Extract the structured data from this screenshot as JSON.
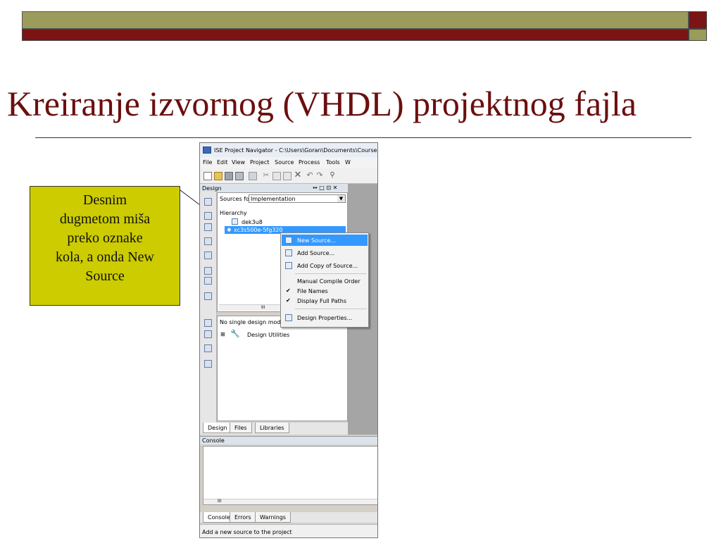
{
  "slide": {
    "title": "Kreiranje izvornog (VHDL) projektnog fajla",
    "callout_lines": [
      "Desnim",
      "dugmetom miša",
      "preko oznake",
      "kola, a onda New",
      "Source"
    ],
    "colors": {
      "olive": "#9b9b5c",
      "dark_red": "#7b1414",
      "callout_yellow": "#cccc00",
      "title": "#6b0f0f"
    }
  },
  "window": {
    "title": "ISE Project Navigator - C:\\Users\\Goran\\Documents\\Courses",
    "menu": [
      "File",
      "Edit",
      "View",
      "Project",
      "Source",
      "Process",
      "Tools",
      "W"
    ],
    "toolbar_icons": [
      "new-file-icon",
      "open-folder-icon",
      "save-icon",
      "save-all-icon",
      "print-icon",
      "cut-icon",
      "copy-icon",
      "paste-icon",
      "delete-icon",
      "undo-icon",
      "redo-icon",
      "find-icon"
    ],
    "design_panel": {
      "header": "Design",
      "header_controls": "↔ □ ⊡ ✕",
      "sources_for_label": "Sources for:",
      "sources_for_value": "Implementation",
      "hierarchy_label": "Hierarchy",
      "tree": [
        {
          "label": "dek3u8"
        },
        {
          "label": "xc3s500e-5fg320",
          "selected": true
        }
      ],
      "scroll_thumb": "III",
      "process_label": "No single design mod",
      "process_items": [
        "Design Utilities"
      ],
      "tabs": [
        "Design",
        "Files",
        "Libraries"
      ]
    },
    "console": {
      "header": "Console",
      "scroll_thumb": "III",
      "tabs": [
        "Console",
        "Errors",
        "Warnings"
      ]
    },
    "status": "Add a new source to the project"
  },
  "context_menu": {
    "items": [
      {
        "label": "New Source...",
        "highlighted": true,
        "icon": "new-source-icon"
      },
      {
        "label": "Add Source...",
        "icon": "add-source-icon"
      },
      {
        "label": "Add Copy of Source...",
        "icon": "add-copy-icon"
      },
      {
        "label": "Manual Compile Order"
      },
      {
        "label": "File Names",
        "checked": true
      },
      {
        "label": "Display Full Paths",
        "checked": true
      },
      {
        "label": "Design Properties...",
        "icon": "design-properties-icon"
      }
    ]
  }
}
